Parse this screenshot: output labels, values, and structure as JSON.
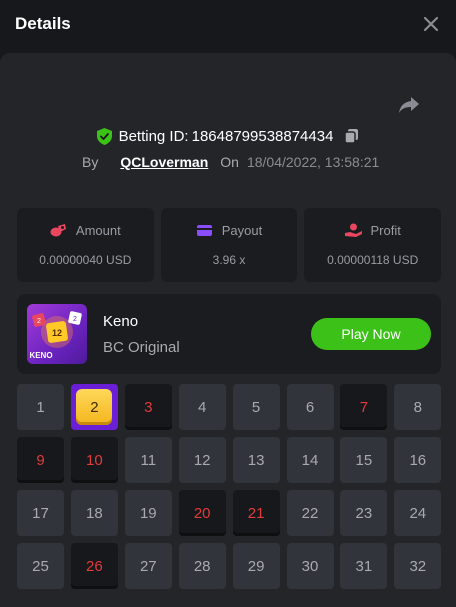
{
  "header": {
    "title": "Details"
  },
  "bet": {
    "betting_id_label": "Betting ID:",
    "betting_id": "18648799538874434",
    "by_label": "By",
    "user": "QCLoverman",
    "on_label": "On",
    "datetime": "18/04/2022, 13:58:21"
  },
  "stats": [
    {
      "label": "Amount",
      "value": "0.00000040 USD",
      "icon": "coins-icon",
      "color": "#e8475f"
    },
    {
      "label": "Payout",
      "value": "3.96 x",
      "icon": "card-icon",
      "color": "#8a4dfb"
    },
    {
      "label": "Profit",
      "value": "0.00000118 USD",
      "icon": "hand-coin-icon",
      "color": "#e8475f"
    }
  ],
  "game": {
    "name": "Keno",
    "provider": "BC Original",
    "play_label": "Play Now",
    "thumb_label": "KENO",
    "thumb_numbers": [
      "2",
      "12",
      "2"
    ]
  },
  "board": {
    "numbers": [
      "1",
      "2",
      "3",
      "4",
      "5",
      "6",
      "7",
      "8",
      "9",
      "10",
      "11",
      "12",
      "13",
      "14",
      "15",
      "16",
      "17",
      "18",
      "19",
      "20",
      "21",
      "22",
      "23",
      "24",
      "25",
      "26",
      "27",
      "28",
      "29",
      "30",
      "31",
      "32"
    ],
    "picked": [
      "3",
      "7",
      "9",
      "10",
      "20",
      "21",
      "26"
    ],
    "hit": [
      "2"
    ]
  },
  "colors": {
    "accent_green": "#3bc117",
    "hit_purple": "#6a1fd6",
    "miss_red": "#e13b3b"
  }
}
